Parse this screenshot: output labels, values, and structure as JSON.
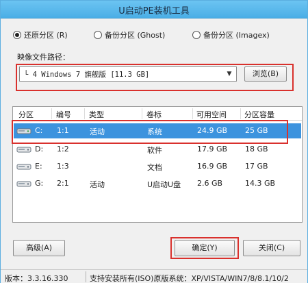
{
  "window": {
    "title": "U启动PE装机工具"
  },
  "mode": {
    "options": [
      {
        "label": "还原分区 (R)",
        "selected": true
      },
      {
        "label": "备份分区 (Ghost)",
        "selected": false
      },
      {
        "label": "备份分区 (Imagex)",
        "selected": false
      }
    ]
  },
  "image_path": {
    "label": "映像文件路径：",
    "value": "└ 4 Windows 7 旗舰版 [11.3 GB]",
    "browse_label": "浏览(B)"
  },
  "partitions": {
    "columns": [
      "分区",
      "编号",
      "类型",
      "卷标",
      "可用空间",
      "分区容量"
    ],
    "rows": [
      {
        "drive": "C:",
        "number": "1:1",
        "type": "活动",
        "label": "系统",
        "free": "24.9 GB",
        "size": "25 GB",
        "selected": true
      },
      {
        "drive": "D:",
        "number": "1:2",
        "type": "",
        "label": "软件",
        "free": "17.9 GB",
        "size": "18 GB",
        "selected": false
      },
      {
        "drive": "E:",
        "number": "1:3",
        "type": "",
        "label": "文档",
        "free": "16.9 GB",
        "size": "17 GB",
        "selected": false
      },
      {
        "drive": "G:",
        "number": "2:1",
        "type": "活动",
        "label": "U启动U盘",
        "free": "2.6 GB",
        "size": "14.3 GB",
        "selected": false
      }
    ]
  },
  "buttons": {
    "advanced": "高级(A)",
    "ok": "确定(Y)",
    "close": "关闭(C)"
  },
  "status": {
    "version": "版本：3.3.16.330",
    "support": "支持安装所有(ISO)原版系统：XP/VISTA/WIN7/8/8.1/10/2"
  },
  "colors": {
    "title_bar": "#4aaee6",
    "selection": "#3c93de",
    "highlight_box": "#d9312d"
  },
  "icons": {
    "drive": "hard-drive-icon",
    "dropdown": "chevron-down-icon"
  }
}
